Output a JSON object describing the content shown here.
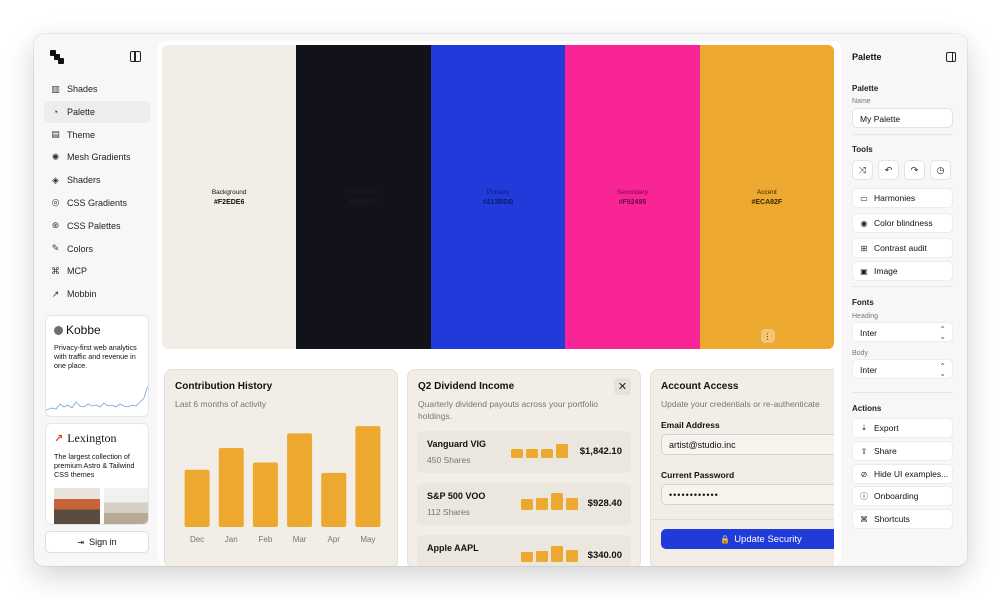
{
  "nav": {
    "items": [
      {
        "label": "Shades",
        "icon": "shades-icon",
        "glyph": "▥",
        "active": false
      },
      {
        "label": "Palette",
        "icon": "palette-icon",
        "glyph": "◔",
        "active": true
      },
      {
        "label": "Theme",
        "icon": "theme-icon",
        "glyph": "▤",
        "active": false
      },
      {
        "label": "Mesh Gradients",
        "icon": "sun-icon",
        "glyph": "✺",
        "active": false
      },
      {
        "label": "Shaders",
        "icon": "shaders-icon",
        "glyph": "◈",
        "active": false
      },
      {
        "label": "CSS Gradients",
        "icon": "database-icon",
        "glyph": "◎",
        "active": false
      },
      {
        "label": "CSS Palettes",
        "icon": "blend-icon",
        "glyph": "⊛",
        "active": false
      },
      {
        "label": "Colors",
        "icon": "pipette-icon",
        "glyph": "✎",
        "active": false
      },
      {
        "label": "MCP",
        "icon": "mcp-icon",
        "glyph": "⌘",
        "active": false
      },
      {
        "label": "Mobbin",
        "icon": "arrow-up-right-icon",
        "glyph": "↗",
        "active": false
      }
    ]
  },
  "ads": {
    "kobbe": {
      "name": "Kobbe",
      "text": "Privacy-first web analytics with traffic and revenue in one place."
    },
    "lexington": {
      "mark": "↗",
      "name": "Lexington",
      "text": "The largest collection of premium Astro & Tailwind CSS themes"
    }
  },
  "signin": {
    "label": "Sign in",
    "glyph": "⇥"
  },
  "swatches": [
    {
      "name": "Background",
      "hex": "#F2EDE6",
      "color": "#F2EDE6",
      "text_color": "#111111"
    },
    {
      "name": "Foreground",
      "hex": "#11121A",
      "color": "#11121A",
      "text_color": "#1c1d26"
    },
    {
      "name": "Primary",
      "hex": "#213BDB",
      "color": "#213BDB",
      "text_color": "#0c1a6e"
    },
    {
      "name": "Secondary",
      "hex": "#F92495",
      "color": "#F92495",
      "text_color": "#6e0c40"
    },
    {
      "name": "Accent",
      "hex": "#ECA82F",
      "color": "#ECA82F",
      "text_color": "#3a2a00"
    }
  ],
  "accent_menu_glyph": "⋮",
  "contribution": {
    "title": "Contribution History",
    "subtitle": "Last 6 months of activity"
  },
  "chart_data": {
    "type": "bar",
    "title": "Contribution History",
    "subtitle": "Last 6 months of activity",
    "categories": [
      "Dec",
      "Jan",
      "Feb",
      "Mar",
      "Apr",
      "May"
    ],
    "values": [
      55,
      76,
      62,
      90,
      52,
      97
    ],
    "ylim": [
      0,
      100
    ],
    "grid": false,
    "legend": "none",
    "bar_color": "#ECA82F"
  },
  "dividend": {
    "title": "Q2 Dividend Income",
    "subtitle": "Quarterly dividend payouts across your portfolio holdings.",
    "close_glyph": "✕",
    "holdings": [
      {
        "name": "Vanguard VIG",
        "shares": "450 Shares",
        "amount": "$1,842.10",
        "bars": [
          0.45,
          0.45,
          0.45,
          0.7
        ]
      },
      {
        "name": "S&P 500 VOO",
        "shares": "112 Shares",
        "amount": "$928.40",
        "bars": [
          0.55,
          0.6,
          0.85,
          0.6
        ]
      },
      {
        "name": "Apple AAPL",
        "shares": "",
        "amount": "$340.00",
        "bars": [
          0.5,
          0.55,
          0.8,
          0.6
        ]
      }
    ]
  },
  "account": {
    "title": "Account Access",
    "subtitle": "Update your credentials or re-authenticate",
    "email_label": "Email Address",
    "email_value": "artist@studio.inc",
    "password_label": "Current Password",
    "password_value": "••••••••••••",
    "update_label": "Update Security",
    "update_glyph": "🔒"
  },
  "panel": {
    "title": "Palette",
    "palette_section": "Palette",
    "name_label": "Name",
    "name_value": "My Palette",
    "tools_section": "Tools",
    "tool_icons": [
      {
        "icon": "shuffle-icon",
        "glyph": "⤨"
      },
      {
        "icon": "undo-icon",
        "glyph": "↶"
      },
      {
        "icon": "redo-icon",
        "glyph": "↷"
      },
      {
        "icon": "history-icon",
        "glyph": "◷"
      }
    ],
    "tools": [
      {
        "label": "Harmonies",
        "icon": "harmonies-icon",
        "glyph": "▭"
      },
      {
        "label": "Color blindness",
        "icon": "eye-icon",
        "glyph": "◉"
      },
      {
        "label": "Contrast audit",
        "icon": "grid-icon",
        "glyph": "⊞"
      },
      {
        "label": "Image",
        "icon": "image-icon",
        "glyph": "▣"
      }
    ],
    "fonts_section": "Fonts",
    "heading_label": "Heading",
    "heading_value": "Inter",
    "body_label": "Body",
    "body_value": "Inter",
    "actions_section": "Actions",
    "actions": [
      {
        "label": "Export",
        "icon": "export-icon",
        "glyph": "⤓"
      },
      {
        "label": "Share",
        "icon": "share-icon",
        "glyph": "⇪"
      },
      {
        "label": "Hide UI examples...",
        "icon": "eye-off-icon",
        "glyph": "⊘"
      },
      {
        "label": "Onboarding",
        "icon": "info-icon",
        "glyph": "ⓘ"
      },
      {
        "label": "Shortcuts",
        "icon": "command-icon",
        "glyph": "⌘"
      }
    ]
  }
}
